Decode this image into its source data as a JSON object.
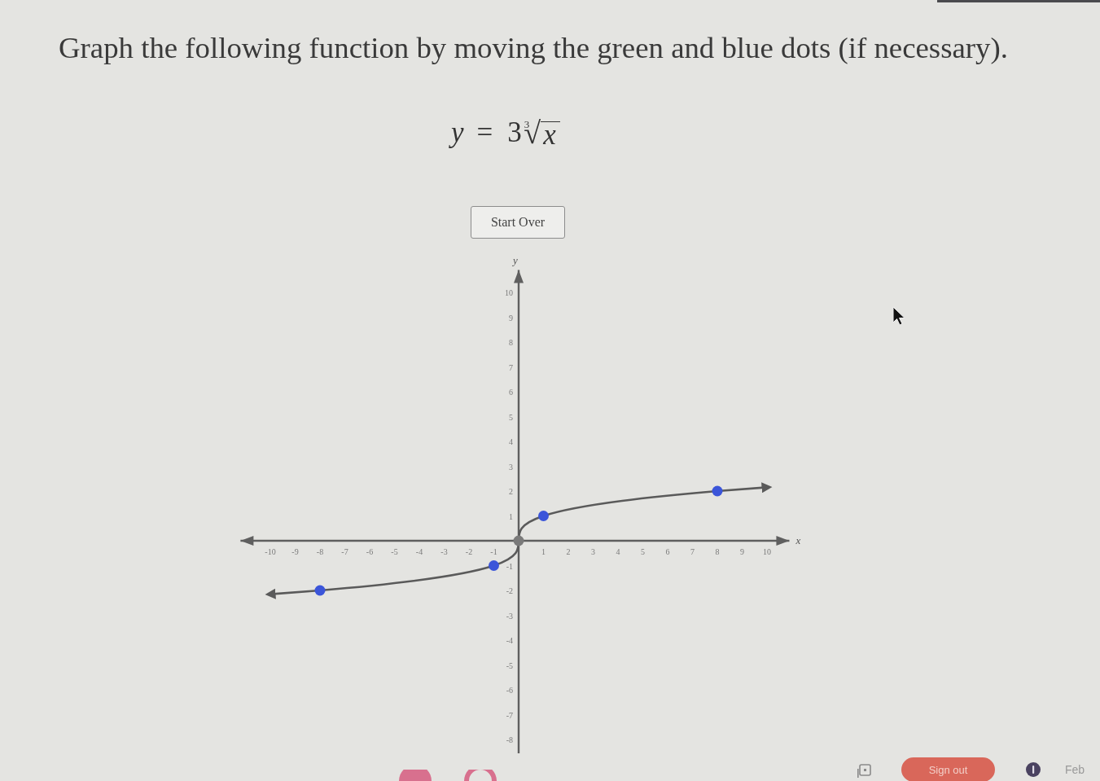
{
  "instruction": "Graph the following function by moving the green and blue dots (if necessary).",
  "equation": {
    "lhs": "y",
    "relation": "=",
    "coefficient": "3",
    "root_index": "3",
    "radical": "√",
    "radicand": "x"
  },
  "start_over_button": "Start Over",
  "graph": {
    "chart_data": {
      "type": "line",
      "xlabel": "x",
      "ylabel": "y",
      "x": [
        -10,
        -8,
        -1,
        0,
        1,
        8,
        10
      ],
      "values": [
        -2.15,
        -2,
        -1,
        0,
        1,
        2,
        2.15
      ],
      "marker": "circle",
      "xlim": [
        -11.2,
        10.9
      ],
      "ylim": [
        -8.7,
        10.9
      ],
      "xticks": [
        -10,
        -9,
        -8,
        -7,
        -6,
        -5,
        -4,
        -3,
        -2,
        -1,
        1,
        2,
        3,
        4,
        5,
        6,
        7,
        8,
        9,
        10
      ],
      "yticks": [
        -8,
        -7,
        -6,
        -5,
        -4,
        -3,
        -2,
        -1,
        1,
        2,
        3,
        4,
        5,
        6,
        7,
        8,
        9,
        10
      ]
    },
    "handles": [
      {
        "color": "#3b55d9"
      },
      {
        "color": "#3b55d9"
      },
      {
        "color": "#7a7a7a"
      },
      {
        "color": "#3b55d9"
      },
      {
        "color": "#3b55d9"
      }
    ]
  },
  "shelf": {
    "sign_out": "Sign out",
    "date": "Feb"
  }
}
